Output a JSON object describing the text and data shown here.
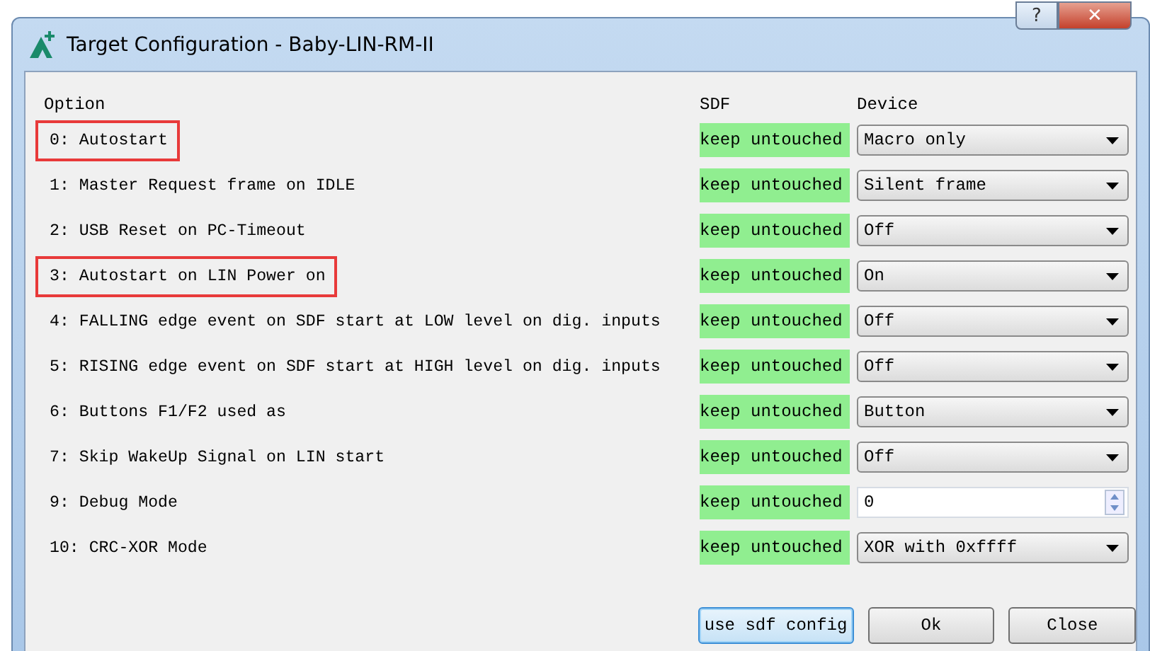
{
  "window": {
    "title": "Target Configuration - Baby-LIN-RM-II",
    "help_button": "?",
    "close_button": "✕"
  },
  "columns": [
    "Option",
    "SDF",
    "Device"
  ],
  "options": [
    {
      "label": "0: Autostart",
      "sdf": "keep untouched",
      "kind": "combo",
      "value": "Macro only",
      "highlighted": true
    },
    {
      "label": "1: Master Request frame on IDLE",
      "sdf": "keep untouched",
      "kind": "combo",
      "value": "Silent frame",
      "highlighted": false
    },
    {
      "label": "2: USB Reset on PC-Timeout",
      "sdf": "keep untouched",
      "kind": "combo",
      "value": "Off",
      "highlighted": false
    },
    {
      "label": "3: Autostart on LIN Power on",
      "sdf": "keep untouched",
      "kind": "combo",
      "value": "On",
      "highlighted": true
    },
    {
      "label": "4: FALLING edge event on SDF start at LOW level on dig. inputs",
      "sdf": "keep untouched",
      "kind": "combo",
      "value": "Off",
      "highlighted": false
    },
    {
      "label": "5: RISING edge event on SDF start at HIGH level on dig. inputs",
      "sdf": "keep untouched",
      "kind": "combo",
      "value": "Off",
      "highlighted": false
    },
    {
      "label": "6: Buttons F1/F2 used as",
      "sdf": "keep untouched",
      "kind": "combo",
      "value": "Button",
      "highlighted": false
    },
    {
      "label": "7: Skip WakeUp Signal on LIN start",
      "sdf": "keep untouched",
      "kind": "combo",
      "value": "Off",
      "highlighted": false
    },
    {
      "label": "9: Debug Mode",
      "sdf": "keep untouched",
      "kind": "spin",
      "value": "0",
      "highlighted": false
    },
    {
      "label": "10: CRC-XOR Mode",
      "sdf": "keep untouched",
      "kind": "combo",
      "value": "XOR with 0xffff",
      "highlighted": false
    }
  ],
  "buttons": [
    {
      "label": "use sdf config",
      "focused": true
    },
    {
      "label": "Ok",
      "focused": false
    },
    {
      "label": "Close",
      "focused": false
    }
  ]
}
